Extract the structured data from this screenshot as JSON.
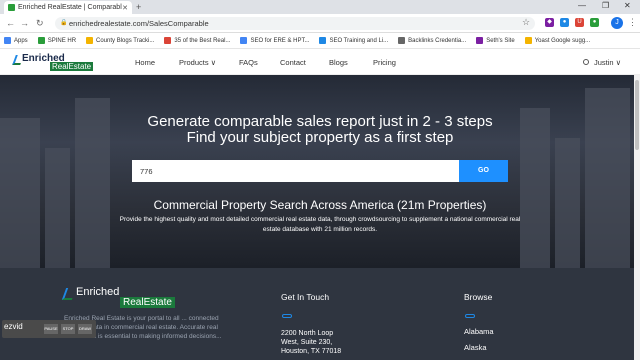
{
  "browser": {
    "tab_title": "Enriched RealEstate | Comparabl",
    "url": "enrichedrealestate.com/SalesComparable",
    "bookmarks": [
      "Apps",
      "SPINE HR",
      "County Blogs Tracki...",
      "35 of the Best Real...",
      "SEO for ERE & HPT...",
      "SEO Training and Li...",
      "Backlinks Credentia...",
      "Seth's Site",
      "Yoast Google sugg..."
    ],
    "profile_initial": "J",
    "bookmark_colors": [
      "#4285f4",
      "#2a9d3a",
      "#f4b400",
      "#db4437",
      "#4285f4",
      "#1e88e5",
      "#666666",
      "#7b1fa2",
      "#f4b400"
    ]
  },
  "site": {
    "logo_top": "Enriched",
    "logo_bottom": "RealEstate",
    "nav": [
      "Home",
      "Products ∨",
      "FAQs",
      "Contact",
      "Blogs",
      "Pricing"
    ],
    "user_name": "Justin ∨"
  },
  "hero": {
    "title_line1": "Generate comparable sales report just in 2 - 3 steps",
    "title_line2": "Find your subject property as a first step",
    "search_value": "776",
    "go_label": "GO",
    "subtitle": "Commercial Property Search Across America (21m Properties)",
    "description": "Provide the highest quality and most detailed commercial real estate data, through crowdsourcing to supplement a national commercial real estate database with 21 million records."
  },
  "footer": {
    "logo_top": "Enriched",
    "logo_bottom": "RealEstate",
    "about": "Enriched Real Estate is your portal to all ... connected with Big Data in commercial real estate. Accurate real estate data is essential to making informed decisions...",
    "touch_heading": "Get In Touch",
    "address_line1": "2200 North Loop",
    "address_line2": "West, Suite 230,",
    "address_line3": "Houston, TX 77018",
    "browse_heading": "Browse",
    "states": [
      "Alabama",
      "Alaska"
    ]
  },
  "recorder": {
    "brand": "ezvid",
    "controls": [
      "PAUSE",
      "STOP",
      "DRAW"
    ]
  },
  "colors": {
    "accent": "#1e90ff",
    "brand_green": "#1b7a3c",
    "footer_bg": "#2f3540"
  }
}
